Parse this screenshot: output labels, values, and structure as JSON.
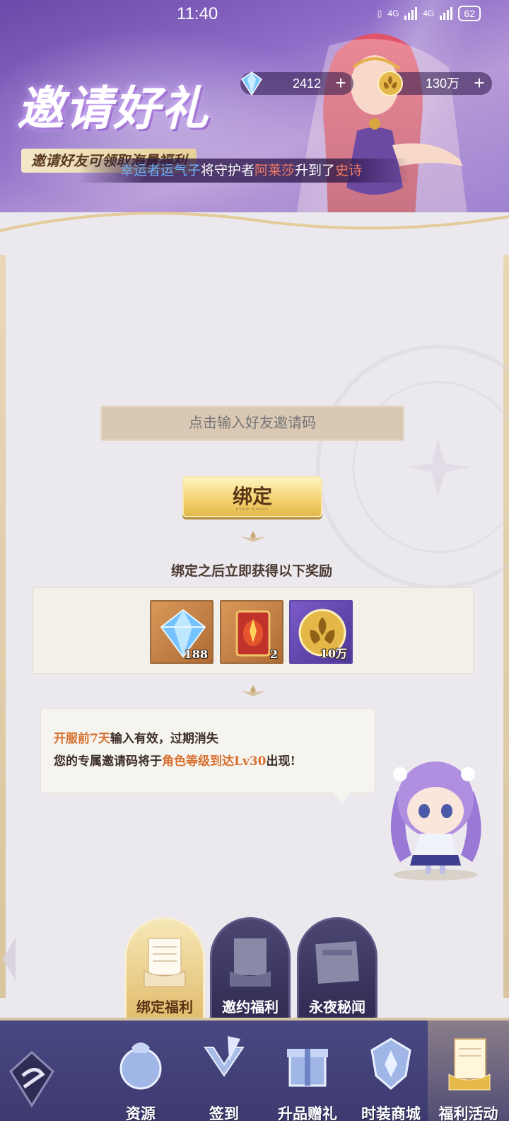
{
  "status_bar": {
    "time": "11:40",
    "net1": "4G",
    "net2": "4G",
    "battery": "62"
  },
  "banner": {
    "title": "邀请好礼",
    "logo_text": "EverNight",
    "subtitle": "邀请好友可领取海量福利",
    "ticker": {
      "lead": "幸运者运气子",
      "mid": "将守护者",
      "name": "阿莱莎",
      "mid2": "升到了",
      "rank": "史诗"
    }
  },
  "currency": {
    "gems": {
      "value": "2412",
      "icon": "diamond-icon"
    },
    "coins": {
      "value": "130万",
      "icon": "fleur-coin-icon"
    }
  },
  "invite": {
    "input_placeholder": "点击输入好友邀请码",
    "bind_label": "绑定",
    "bind_sub": "EVER NIGHT",
    "reward_caption": "绑定之后立即获得以下奖励",
    "rewards": [
      {
        "icon": "diamond-icon",
        "qty": "188"
      },
      {
        "icon": "card-icon",
        "qty": "2"
      },
      {
        "icon": "fleur-coin-icon",
        "qty": "10万"
      }
    ]
  },
  "notice": {
    "line1_hl": "开服前7天",
    "line1_rest": "输入有效，过期消失",
    "line2_pre": "您的专属邀请码将于",
    "line2_hl": "角色等级到达Lv30",
    "line2_post": "出现!"
  },
  "sub_tabs": [
    {
      "label": "绑定福利",
      "active": true
    },
    {
      "label": "邀约福利",
      "active": false
    },
    {
      "label": "永夜秘闻",
      "active": false
    }
  ],
  "bottom_nav": [
    {
      "label": "资源",
      "icon": "bag-icon"
    },
    {
      "label": "签到",
      "icon": "quill-icon"
    },
    {
      "label": "升品赠礼",
      "icon": "gift-icon"
    },
    {
      "label": "时装商城",
      "icon": "shield-icon"
    },
    {
      "label": "福利活动",
      "icon": "scroll-icon",
      "active": true
    }
  ],
  "colors": {
    "accent": "#d6702f",
    "gold": "#e5b94a",
    "nav": "#3c3a6e"
  }
}
